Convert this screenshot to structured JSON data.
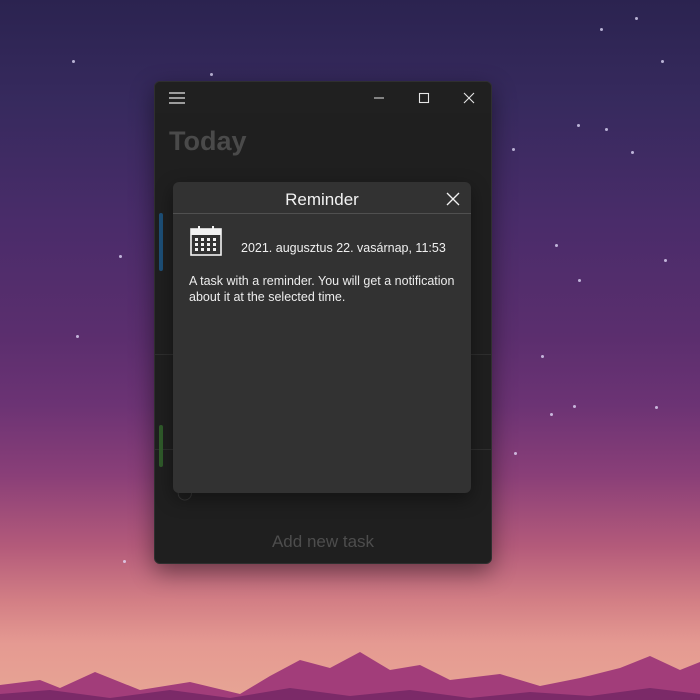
{
  "window": {
    "menu_icon": "hamburger-menu-icon",
    "minimize_icon": "minimize-icon",
    "maximize_icon": "maximize-icon",
    "close_icon": "close-icon"
  },
  "page": {
    "title": "Today",
    "add_task_label": "Add new task"
  },
  "dialog": {
    "title": "Reminder",
    "close_icon": "close-icon",
    "date_icon": "calendar-icon",
    "datetime": "2021. augusztus 22. vasárnap, 11:53",
    "description": "A task with a reminder. You will get a notification about it at the selected time."
  },
  "colors": {
    "window_bg": "#1f1f1f",
    "dialog_bg": "#323232",
    "text_primary": "#f2f2f2",
    "accent_blue": "#1d4f77",
    "accent_green": "#2f5a2a"
  }
}
